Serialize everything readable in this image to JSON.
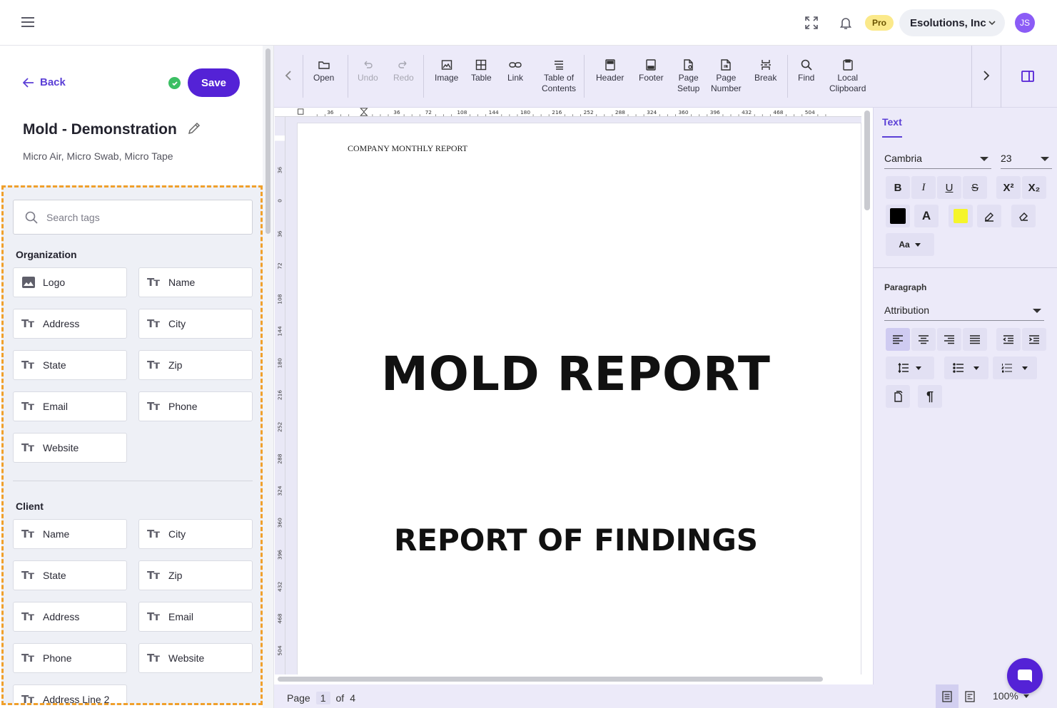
{
  "topbar": {
    "pro_badge": "Pro",
    "org_name": "Esolutions, Inc",
    "avatar_initials": "JS"
  },
  "left": {
    "back_label": "Back",
    "save_label": "Save",
    "title": "Mold - Demonstration",
    "subtitle": "Micro Air, Micro Swab, Micro Tape",
    "search_placeholder": "Search tags",
    "organization": {
      "title": "Organization",
      "tags": [
        "Logo",
        "Name",
        "Address",
        "City",
        "State",
        "Zip",
        "Email",
        "Phone",
        "Website"
      ]
    },
    "client": {
      "title": "Client",
      "tags": [
        "Name",
        "City",
        "State",
        "Zip",
        "Address",
        "Email",
        "Phone",
        "Website",
        "Address Line 2"
      ]
    }
  },
  "toolbar": {
    "open": "Open",
    "undo": "Undo",
    "redo": "Redo",
    "image": "Image",
    "table": "Table",
    "link": "Link",
    "toc_1": "Table of",
    "toc_2": "Contents",
    "header": "Header",
    "footer": "Footer",
    "page_setup_1": "Page",
    "page_setup_2": "Setup",
    "page_number_1": "Page",
    "page_number_2": "Number",
    "break": "Break",
    "find": "Find",
    "clipboard_1": "Local",
    "clipboard_2": "Clipboard"
  },
  "ruler": {
    "horizontal": [
      "36",
      "36",
      "72",
      "108",
      "144",
      "180",
      "216",
      "252",
      "288",
      "324",
      "360",
      "396",
      "432",
      "468",
      "504"
    ],
    "vertical": [
      "36",
      "0",
      "36",
      "72",
      "108",
      "144",
      "180",
      "216",
      "252",
      "288",
      "324",
      "360",
      "396",
      "432",
      "468",
      "504"
    ]
  },
  "document": {
    "header_text": "COMPANY MONTHLY REPORT",
    "heading_1": "MOLD REPORT",
    "heading_2": "REPORT OF FINDINGS"
  },
  "status": {
    "page_label": "Page",
    "page_current": "1",
    "page_of": "of",
    "page_total": "4",
    "zoom": "100%"
  },
  "rpanel": {
    "tab_text": "Text",
    "font": "Cambria",
    "size": "23",
    "superscript": "X²",
    "subscript": "X₂",
    "case_label": "Aa",
    "paragraph_label": "Paragraph",
    "style": "Attribution",
    "text_color": "#000000",
    "highlight_color": "#f5f52a"
  },
  "colors": {
    "accent": "#5422d6",
    "dashed_border": "#f0a02c"
  }
}
